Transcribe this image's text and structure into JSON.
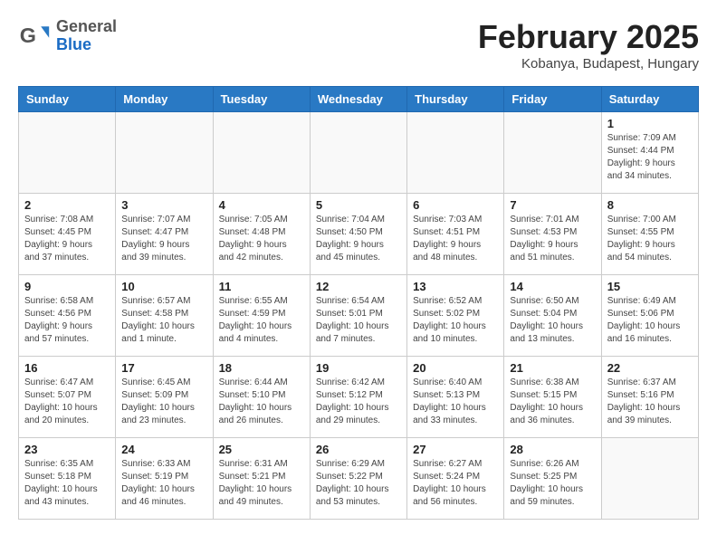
{
  "header": {
    "logo_general": "General",
    "logo_blue": "Blue",
    "month_title": "February 2025",
    "location": "Kobanya, Budapest, Hungary"
  },
  "weekdays": [
    "Sunday",
    "Monday",
    "Tuesday",
    "Wednesday",
    "Thursday",
    "Friday",
    "Saturday"
  ],
  "weeks": [
    [
      {
        "day": "",
        "info": ""
      },
      {
        "day": "",
        "info": ""
      },
      {
        "day": "",
        "info": ""
      },
      {
        "day": "",
        "info": ""
      },
      {
        "day": "",
        "info": ""
      },
      {
        "day": "",
        "info": ""
      },
      {
        "day": "1",
        "info": "Sunrise: 7:09 AM\nSunset: 4:44 PM\nDaylight: 9 hours and 34 minutes."
      }
    ],
    [
      {
        "day": "2",
        "info": "Sunrise: 7:08 AM\nSunset: 4:45 PM\nDaylight: 9 hours and 37 minutes."
      },
      {
        "day": "3",
        "info": "Sunrise: 7:07 AM\nSunset: 4:47 PM\nDaylight: 9 hours and 39 minutes."
      },
      {
        "day": "4",
        "info": "Sunrise: 7:05 AM\nSunset: 4:48 PM\nDaylight: 9 hours and 42 minutes."
      },
      {
        "day": "5",
        "info": "Sunrise: 7:04 AM\nSunset: 4:50 PM\nDaylight: 9 hours and 45 minutes."
      },
      {
        "day": "6",
        "info": "Sunrise: 7:03 AM\nSunset: 4:51 PM\nDaylight: 9 hours and 48 minutes."
      },
      {
        "day": "7",
        "info": "Sunrise: 7:01 AM\nSunset: 4:53 PM\nDaylight: 9 hours and 51 minutes."
      },
      {
        "day": "8",
        "info": "Sunrise: 7:00 AM\nSunset: 4:55 PM\nDaylight: 9 hours and 54 minutes."
      }
    ],
    [
      {
        "day": "9",
        "info": "Sunrise: 6:58 AM\nSunset: 4:56 PM\nDaylight: 9 hours and 57 minutes."
      },
      {
        "day": "10",
        "info": "Sunrise: 6:57 AM\nSunset: 4:58 PM\nDaylight: 10 hours and 1 minute."
      },
      {
        "day": "11",
        "info": "Sunrise: 6:55 AM\nSunset: 4:59 PM\nDaylight: 10 hours and 4 minutes."
      },
      {
        "day": "12",
        "info": "Sunrise: 6:54 AM\nSunset: 5:01 PM\nDaylight: 10 hours and 7 minutes."
      },
      {
        "day": "13",
        "info": "Sunrise: 6:52 AM\nSunset: 5:02 PM\nDaylight: 10 hours and 10 minutes."
      },
      {
        "day": "14",
        "info": "Sunrise: 6:50 AM\nSunset: 5:04 PM\nDaylight: 10 hours and 13 minutes."
      },
      {
        "day": "15",
        "info": "Sunrise: 6:49 AM\nSunset: 5:06 PM\nDaylight: 10 hours and 16 minutes."
      }
    ],
    [
      {
        "day": "16",
        "info": "Sunrise: 6:47 AM\nSunset: 5:07 PM\nDaylight: 10 hours and 20 minutes."
      },
      {
        "day": "17",
        "info": "Sunrise: 6:45 AM\nSunset: 5:09 PM\nDaylight: 10 hours and 23 minutes."
      },
      {
        "day": "18",
        "info": "Sunrise: 6:44 AM\nSunset: 5:10 PM\nDaylight: 10 hours and 26 minutes."
      },
      {
        "day": "19",
        "info": "Sunrise: 6:42 AM\nSunset: 5:12 PM\nDaylight: 10 hours and 29 minutes."
      },
      {
        "day": "20",
        "info": "Sunrise: 6:40 AM\nSunset: 5:13 PM\nDaylight: 10 hours and 33 minutes."
      },
      {
        "day": "21",
        "info": "Sunrise: 6:38 AM\nSunset: 5:15 PM\nDaylight: 10 hours and 36 minutes."
      },
      {
        "day": "22",
        "info": "Sunrise: 6:37 AM\nSunset: 5:16 PM\nDaylight: 10 hours and 39 minutes."
      }
    ],
    [
      {
        "day": "23",
        "info": "Sunrise: 6:35 AM\nSunset: 5:18 PM\nDaylight: 10 hours and 43 minutes."
      },
      {
        "day": "24",
        "info": "Sunrise: 6:33 AM\nSunset: 5:19 PM\nDaylight: 10 hours and 46 minutes."
      },
      {
        "day": "25",
        "info": "Sunrise: 6:31 AM\nSunset: 5:21 PM\nDaylight: 10 hours and 49 minutes."
      },
      {
        "day": "26",
        "info": "Sunrise: 6:29 AM\nSunset: 5:22 PM\nDaylight: 10 hours and 53 minutes."
      },
      {
        "day": "27",
        "info": "Sunrise: 6:27 AM\nSunset: 5:24 PM\nDaylight: 10 hours and 56 minutes."
      },
      {
        "day": "28",
        "info": "Sunrise: 6:26 AM\nSunset: 5:25 PM\nDaylight: 10 hours and 59 minutes."
      },
      {
        "day": "",
        "info": ""
      }
    ]
  ]
}
